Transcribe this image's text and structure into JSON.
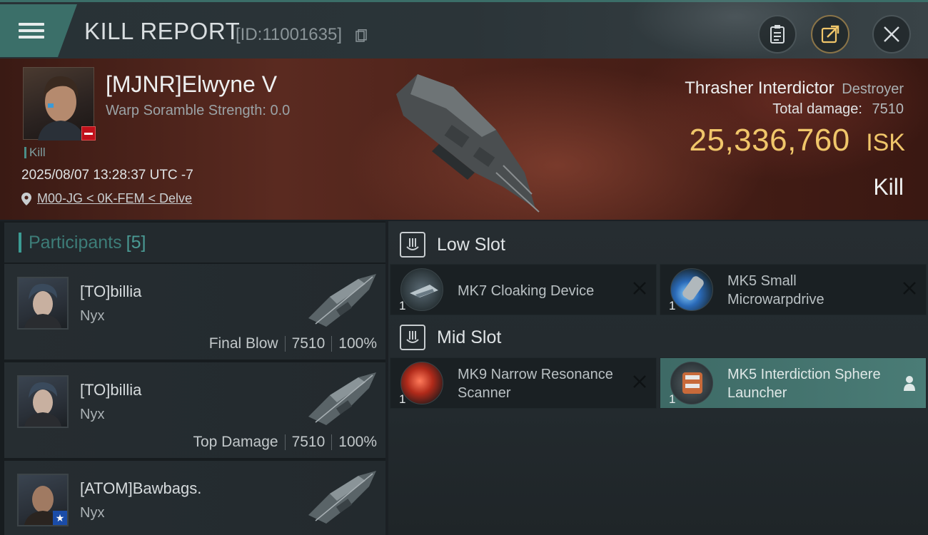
{
  "header": {
    "title": "KILL REPORT",
    "id_label": "[ID:11001635]"
  },
  "victim": {
    "name": "[MJNR]Elwyne V",
    "warp_strength": "Warp Soramble Strength: 0.0",
    "kill_tag": "Kill",
    "timestamp": "2025/08/07 13:28:37 UTC -7",
    "location": "M00-JG < 0K-FEM < Delve",
    "ship_name": "Thrasher Interdictor",
    "ship_class": "Destroyer",
    "total_damage_label": "Total damage:",
    "total_damage_value": "7510",
    "isk_value": "25,336,760",
    "isk_unit": "ISK",
    "result": "Kill"
  },
  "participants": {
    "label": "Participants",
    "count": "[5]",
    "rows": [
      {
        "name": "[TO]billia",
        "ship": "Nyx",
        "role": "Final Blow",
        "damage": "7510",
        "percent": "100%"
      },
      {
        "name": "[TO]billia",
        "ship": "Nyx",
        "role": "Top Damage",
        "damage": "7510",
        "percent": "100%"
      },
      {
        "name": "[ATOM]Bawbags.",
        "ship": "Nyx",
        "role": "",
        "damage": "",
        "percent": ""
      }
    ]
  },
  "slots": {
    "low": {
      "label": "Low Slot",
      "modules": [
        {
          "name": "MK7 Cloaking Device",
          "qty": "1"
        },
        {
          "name": "MK5 Small Microwarpdrive",
          "qty": "1"
        }
      ]
    },
    "mid": {
      "label": "Mid Slot",
      "modules": [
        {
          "name": "MK9 Narrow Resonance Scanner",
          "qty": "1"
        },
        {
          "name": "MK5 Interdiction Sphere Launcher",
          "qty": "1"
        }
      ]
    }
  },
  "colors": {
    "accent": "#3b6f69",
    "isk_gold": "#f0c66a",
    "banner": "#5a2a20"
  }
}
